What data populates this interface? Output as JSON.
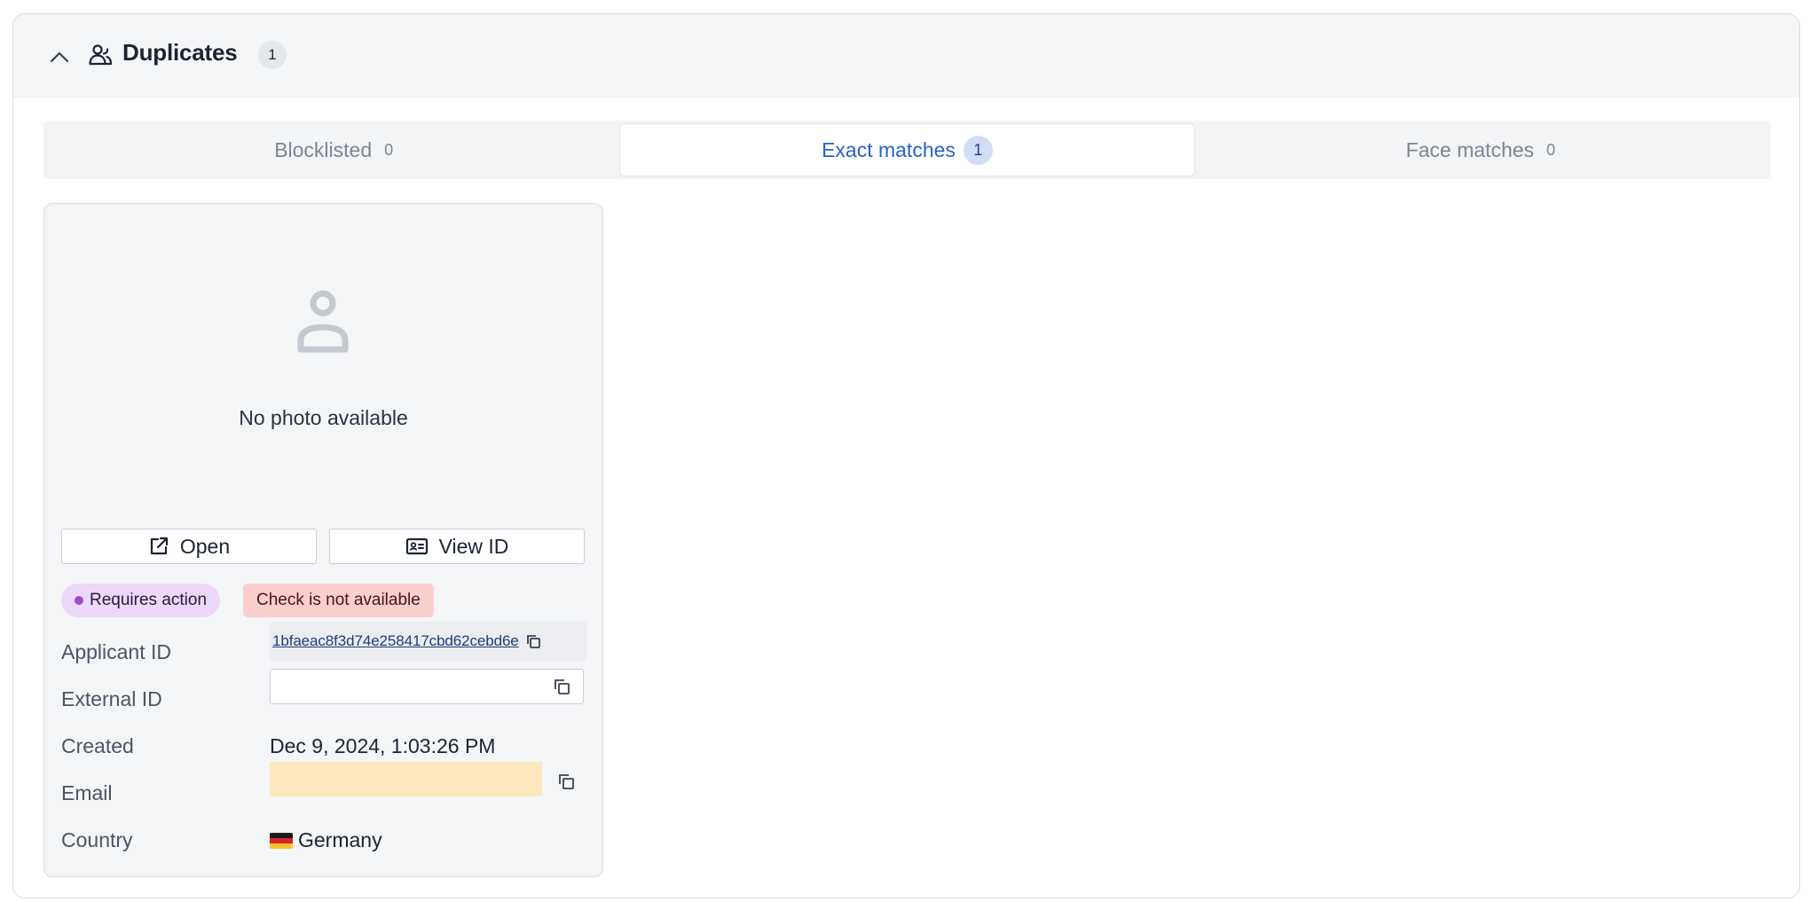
{
  "header": {
    "title": "Duplicates",
    "count": "1",
    "icons": {
      "collapse": "chevron-up-icon",
      "section": "user-group-icon"
    }
  },
  "tabs": [
    {
      "label": "Blocklisted",
      "count": "0",
      "active": false
    },
    {
      "label": "Exact matches",
      "count": "1",
      "active": true
    },
    {
      "label": "Face matches",
      "count": "0",
      "active": false
    }
  ],
  "card": {
    "placeholder_icon": "user-icon",
    "no_photo_text": "No photo available",
    "open_button": "Open",
    "view_id_button": "View ID",
    "badges": {
      "status": "Requires action",
      "check": "Check is not available"
    },
    "fields": {
      "applicant_id_label": "Applicant ID",
      "applicant_id_value": "1bfaeac8f3d74e258417cbd62cebd6e",
      "external_id_label": "External ID",
      "external_id_value": "",
      "created_label": "Created",
      "created_value": "Dec 9, 2024, 1:03:26 PM",
      "email_label": "Email",
      "country_label": "Country",
      "country_value": "Germany"
    }
  },
  "colors": {
    "accent": "#2563c9",
    "status_badge_bg": "#ecd8f8",
    "check_badge_bg": "#fbcfcd",
    "email_highlight": "#fde7bd"
  }
}
